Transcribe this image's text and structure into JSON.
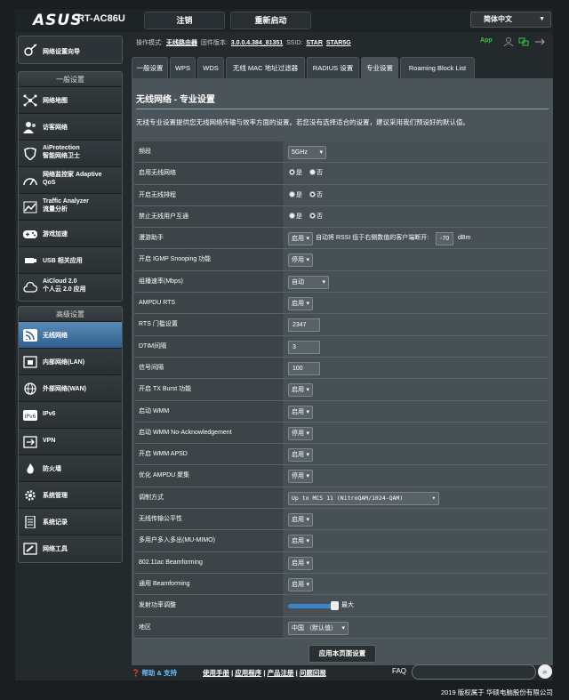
{
  "header": {
    "brand": "ASUS",
    "model": "RT-AC86U",
    "logout_label": "注销",
    "reboot_label": "重新启动",
    "language": "简体中文"
  },
  "info_bar": {
    "mode_label": "操作模式:",
    "mode_value": "无线路由器",
    "firmware_label": "固件版本:",
    "firmware_value": "3.0.0.4.384_81351",
    "ssid_label": "SSID:",
    "ssid_1": "STAR",
    "ssid_2": "STAR5G",
    "app_label": "App"
  },
  "sidebar": {
    "wizard": "网络设置向导",
    "general_header": "一般设置",
    "general_items": [
      {
        "label": "网络地图"
      },
      {
        "label": "访客网络"
      },
      {
        "label": "AiProtection",
        "sub": "智能网络卫士"
      },
      {
        "label": "网络监控家 Adaptive",
        "sub": "QoS"
      },
      {
        "label": "Traffic Analyzer",
        "sub": "流量分析"
      },
      {
        "label": "游戏加速"
      },
      {
        "label": "USB 相关应用"
      },
      {
        "label": "AiCloud 2.0",
        "sub": "个人云 2.0 应用"
      }
    ],
    "advanced_header": "高级设置",
    "advanced_items": [
      {
        "label": "无线网络"
      },
      {
        "label": "内部网络(LAN)"
      },
      {
        "label": "外部网络(WAN)"
      },
      {
        "label": "IPv6"
      },
      {
        "label": "VPN"
      },
      {
        "label": "防火墙"
      },
      {
        "label": "系统管理"
      },
      {
        "label": "系统记录"
      },
      {
        "label": "网络工具"
      }
    ]
  },
  "tabs": [
    "一般设置",
    "WPS",
    "WDS",
    "无线 MAC 地址过滤器",
    "RADIUS 设置",
    "专业设置",
    "Roaming Block List"
  ],
  "page": {
    "title": "无线网络 - 专业设置",
    "description": "无线专业设置提供您无线网络传输与效率方面的设置。若您没有选择适合的设置，建议采用我们预设好的默认值。",
    "apply_label": "应用本页面设置"
  },
  "settings": {
    "band": {
      "label": "频段",
      "value": "5GHz"
    },
    "enable_radio": {
      "label": "启用无线网络",
      "yes": "是",
      "no": "否"
    },
    "schedule": {
      "label": "开启无线排程",
      "yes": "是",
      "no": "否"
    },
    "isolation": {
      "label": "禁止无线用户互通",
      "yes": "是",
      "no": "否"
    },
    "roaming": {
      "label": "漫游助手",
      "value": "启用",
      "text": "自动将 RSSI 低于右侧数值的客户端断开:",
      "rssi": "-70",
      "unit": "dBm"
    },
    "igmp": {
      "label": "开启 IGMP Snooping 功能",
      "value": "停用"
    },
    "multicast_rate": {
      "label": "组播速率(Mbps)",
      "value": "自动"
    },
    "ampdu_rts": {
      "label": "AMPDU RTS",
      "value": "启用"
    },
    "rts_threshold": {
      "label": "RTS 门槛设置",
      "value": "2347"
    },
    "dtim": {
      "label": "DTIM间隔",
      "value": "3"
    },
    "beacon": {
      "label": "信号间隔",
      "value": "100"
    },
    "tx_burst": {
      "label": "开启 TX Burst 功能",
      "value": "启用"
    },
    "wmm": {
      "label": "启动 WMM",
      "value": "启用"
    },
    "wmm_noack": {
      "label": "启动 WMM No-Acknowledgement",
      "value": "停用"
    },
    "wmm_apsd": {
      "label": "开启 WMM APSD",
      "value": "启用"
    },
    "ampdu_agg": {
      "label": "优化 AMPDU 聚集",
      "value": "停用"
    },
    "modulation": {
      "label": "调制方式",
      "value": "Up to MCS 11 (NitroQAM/1024-QAM)"
    },
    "airtime": {
      "label": "无线传输公平性",
      "value": "启用"
    },
    "mumimo": {
      "label": "多用户多入多出(MU-MIMO)",
      "value": "启用"
    },
    "beamforming_ac": {
      "label": "802.11ac Beamforming",
      "value": "启用"
    },
    "beamforming_univ": {
      "label": "通用 Beamforming",
      "value": "启用"
    },
    "tx_power": {
      "label": "发射功率调整",
      "value_text": "最大",
      "level": 1.0
    },
    "region": {
      "label": "地区",
      "value": "中国 （默认值）"
    }
  },
  "footer": {
    "help": "帮助 & 支持",
    "manual": "使用手册",
    "utility": "应用程序",
    "registration": "产品注册",
    "feedback": "问题回报",
    "faq": "FAQ",
    "copyright": "2019 版权属于 华硕电脑股份有限公司"
  },
  "colors": {
    "accent": "#3a86c9",
    "active_nav": "#4a7fae",
    "app_green": "#3cc43c"
  }
}
